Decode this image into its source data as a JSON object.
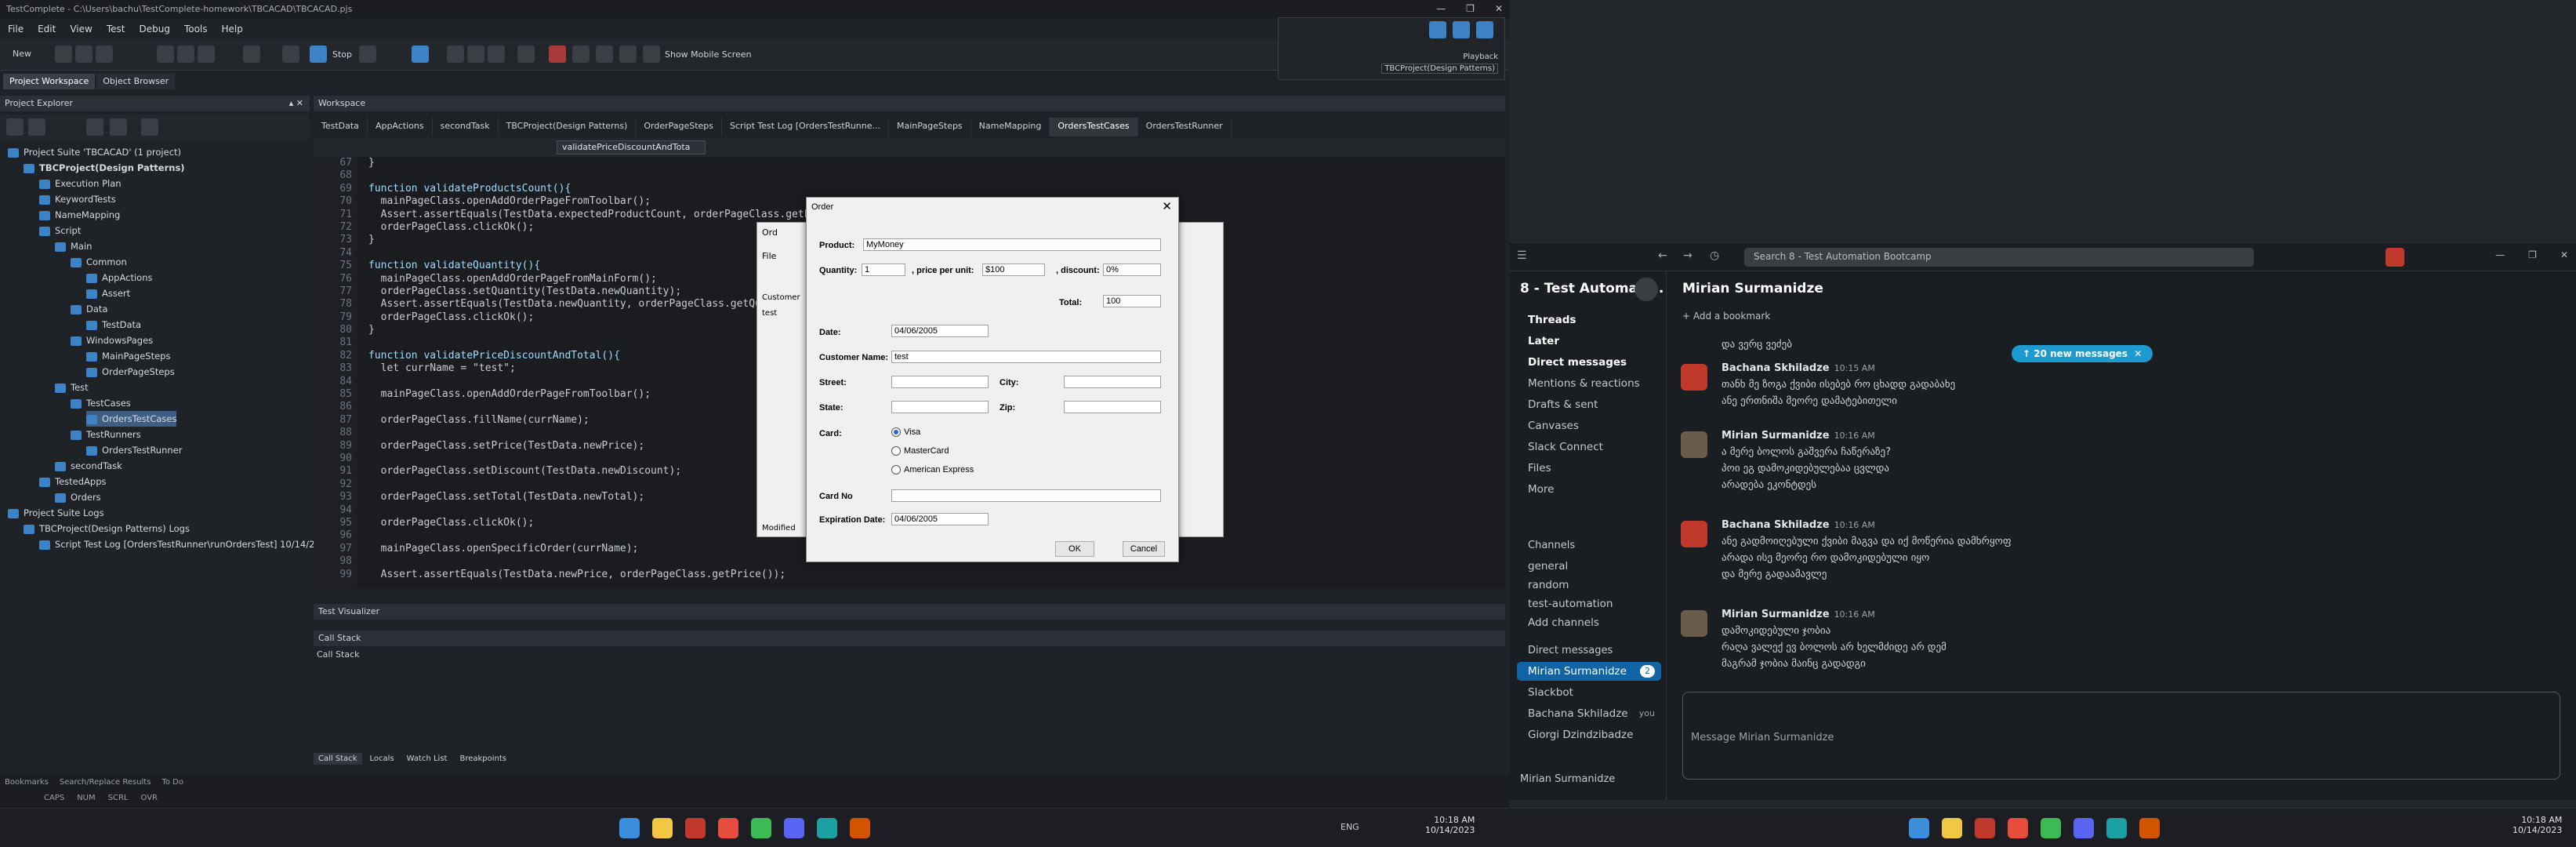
{
  "left": {
    "title": "TestComplete - C:\\Users\\bachu\\TestComplete-homework\\TBCACAD\\TBCACAD.pjs",
    "menu": [
      "File",
      "Edit",
      "View",
      "Test",
      "Debug",
      "Tools",
      "Help"
    ],
    "toolbar": {
      "new_label": "New",
      "stop_label": "Stop",
      "mobile_label": "Show Mobile Screen",
      "playback_label": "Playback",
      "playback_sub": "TBCProject(Design Patterns)"
    },
    "pw_tabs": [
      "Project Workspace",
      "Object Browser"
    ],
    "explorer_title": "Project Explorer",
    "workspace_title": "Workspace",
    "tree": [
      {
        "label": "Project Suite 'TBCACAD' (1 project)",
        "indent": 0,
        "bold": false
      },
      {
        "label": "TBCProject(Design Patterns)",
        "indent": 1,
        "bold": true
      },
      {
        "label": "Execution Plan",
        "indent": 2,
        "bold": false
      },
      {
        "label": "KeywordTests",
        "indent": 2,
        "bold": false
      },
      {
        "label": "NameMapping",
        "indent": 2,
        "bold": false
      },
      {
        "label": "Script",
        "indent": 2,
        "bold": false
      },
      {
        "label": "Main",
        "indent": 3,
        "bold": false
      },
      {
        "label": "Common",
        "indent": 4,
        "bold": false
      },
      {
        "label": "AppActions",
        "indent": 5,
        "bold": false
      },
      {
        "label": "Assert",
        "indent": 5,
        "bold": false
      },
      {
        "label": "Data",
        "indent": 4,
        "bold": false
      },
      {
        "label": "TestData",
        "indent": 5,
        "bold": false
      },
      {
        "label": "WindowsPages",
        "indent": 4,
        "bold": false
      },
      {
        "label": "MainPageSteps",
        "indent": 5,
        "bold": false
      },
      {
        "label": "OrderPageSteps",
        "indent": 5,
        "bold": false
      },
      {
        "label": "Test",
        "indent": 3,
        "bold": false
      },
      {
        "label": "TestCases",
        "indent": 4,
        "bold": false
      },
      {
        "label": "OrdersTestCases",
        "indent": 5,
        "bold": false,
        "selected": true
      },
      {
        "label": "TestRunners",
        "indent": 4,
        "bold": false
      },
      {
        "label": "OrdersTestRunner",
        "indent": 5,
        "bold": false
      },
      {
        "label": "secondTask",
        "indent": 3,
        "bold": false
      },
      {
        "label": "TestedApps",
        "indent": 2,
        "bold": false
      },
      {
        "label": "Orders",
        "indent": 3,
        "bold": false
      },
      {
        "label": "Project Suite Logs",
        "indent": 0,
        "bold": false
      },
      {
        "label": "TBCProject(Design Patterns) Logs",
        "indent": 1,
        "bold": false
      },
      {
        "label": "Script Test Log [OrdersTestRunner\\runOrdersTest] 10/14/2023",
        "indent": 2,
        "bold": false
      }
    ],
    "doc_tabs": [
      "TestData",
      "AppActions",
      "secondTask",
      "TBCProject(Design Patterns)",
      "OrderPageSteps",
      "Script Test Log [OrdersTestRunne...",
      "MainPageSteps",
      "NameMapping",
      "OrdersTestCases",
      "OrdersTestRunner"
    ],
    "function_select": "validatePriceDiscountAndTota",
    "code_lines": [
      {
        "n": "67",
        "t": "}"
      },
      {
        "n": "68",
        "t": ""
      },
      {
        "n": "69",
        "t": "function validateProductsCount(){"
      },
      {
        "n": "70",
        "t": "  mainPageClass.openAddOrderPageFromToolbar();"
      },
      {
        "n": "71",
        "t": "  Assert.assertEquals(TestData.expectedProductCount, orderPageClass.getPr..."
      },
      {
        "n": "72",
        "t": "  orderPageClass.clickOk();"
      },
      {
        "n": "73",
        "t": "}"
      },
      {
        "n": "74",
        "t": ""
      },
      {
        "n": "75",
        "t": "function validateQuantity(){"
      },
      {
        "n": "76",
        "t": "  mainPageClass.openAddOrderPageFromMainForm();"
      },
      {
        "n": "77",
        "t": "  orderPageClass.setQuantity(TestData.newQuantity);"
      },
      {
        "n": "78",
        "t": "  Assert.assertEquals(TestData.newQuantity, orderPageClass.getQuantity());"
      },
      {
        "n": "79",
        "t": "  orderPageClass.clickOk();"
      },
      {
        "n": "80",
        "t": "}"
      },
      {
        "n": "81",
        "t": ""
      },
      {
        "n": "82",
        "t": "function validatePriceDiscountAndTotal(){"
      },
      {
        "n": "83",
        "t": "  let currName = \"test\";"
      },
      {
        "n": "84",
        "t": ""
      },
      {
        "n": "85",
        "t": "  mainPageClass.openAddOrderPageFromToolbar();"
      },
      {
        "n": "86",
        "t": ""
      },
      {
        "n": "87",
        "t": "  orderPageClass.fillName(currName);"
      },
      {
        "n": "88",
        "t": ""
      },
      {
        "n": "89",
        "t": "  orderPageClass.setPrice(TestData.newPrice);"
      },
      {
        "n": "90",
        "t": ""
      },
      {
        "n": "91",
        "t": "  orderPageClass.setDiscount(TestData.newDiscount);"
      },
      {
        "n": "92",
        "t": ""
      },
      {
        "n": "93",
        "t": "  orderPageClass.setTotal(TestData.newTotal);"
      },
      {
        "n": "94",
        "t": ""
      },
      {
        "n": "95",
        "t": "  orderPageClass.clickOk();"
      },
      {
        "n": "96",
        "t": ""
      },
      {
        "n": "97",
        "t": "  mainPageClass.openSpecificOrder(currName);"
      },
      {
        "n": "98",
        "t": ""
      },
      {
        "n": "99",
        "t": "  Assert.assertEquals(TestData.newPrice, orderPageClass.getPrice());"
      }
    ],
    "test_visualizer": "Test Visualizer",
    "call_stack_title": "Call Stack",
    "call_stack_col": "Call Stack",
    "bottom_tabs": [
      "Call Stack",
      "Locals",
      "Watch List",
      "Breakpoints"
    ],
    "status_tabs": [
      "Bookmarks",
      "Search/Replace Results",
      "To Do"
    ],
    "status_keys": [
      "CAPS",
      "NUM",
      "SCRL",
      "OVR"
    ],
    "back_dialog": {
      "title": "Ord",
      "menu": "File",
      "col": "Customer",
      "row": "test",
      "status": "Modified"
    },
    "dialog": {
      "title": "Order",
      "product_label": "Product:",
      "product_value": "MyMoney",
      "quantity_label": "Quantity:",
      "quantity_value": "1",
      "price_label": ", price per unit:",
      "price_value": "$100",
      "discount_label": ", discount:",
      "discount_value": "0%",
      "total_label": "Total:",
      "total_value": "100",
      "date_label": "Date:",
      "date_value": "04/06/2005",
      "customer_label": "Customer Name:",
      "customer_value": "test",
      "street_label": "Street:",
      "city_label": "City:",
      "state_label": "State:",
      "zip_label": "Zip:",
      "card_label": "Card:",
      "cards": [
        "Visa",
        "MasterCard",
        "American Express"
      ],
      "card_selected": "Visa",
      "cardno_label": "Card No",
      "exp_label": "Expiration Date:",
      "exp_value": "04/06/2005",
      "ok_label": "OK",
      "cancel_label": "Cancel"
    },
    "clock": {
      "time": "10:18 AM",
      "date": "10/14/2023",
      "lang": "ENG"
    }
  },
  "right": {
    "search_placeholder": "Search 8 - Test Automation Bootcamp",
    "workspace": "8 - Test Automati...",
    "sidebar_top": [
      "Threads",
      "Later",
      "Direct messages",
      "Mentions & reactions",
      "Drafts & sent",
      "Canvases",
      "Slack Connect",
      "Files",
      "More"
    ],
    "channels_header": "Channels",
    "channels": [
      "general",
      "random",
      "test-automation"
    ],
    "add_channels": "Add channels",
    "dm_header": "Direct messages",
    "dms": [
      {
        "name": "Mirian Surmanidze",
        "badge": "2",
        "selected": true
      },
      {
        "name": "Slackbot",
        "badge": "",
        "selected": false
      },
      {
        "name": "Bachana Skhiladze",
        "badge": "you",
        "selected": false
      },
      {
        "name": "Giorgi Dzindzibadze",
        "badge": "",
        "selected": false
      }
    ],
    "footer_user": "Mirian Surmanidze",
    "channel_title": "Mirian Surmanidze",
    "add_bookmark": "Add a bookmark",
    "new_messages": "20 new messages",
    "messages": [
      {
        "lines": [
          "და ვერც ვეძებ"
        ],
        "name": "",
        "time": ""
      },
      {
        "name": "Bachana Skhiladze",
        "time": "10:15 AM",
        "lines": [
          "თანხ მე ზოგა ქვიბი ისებებ რო ცხადდ გადაბახე",
          "ანე ერთნიშა მეორე დამატებითელი"
        ]
      },
      {
        "name": "Mirian Surmanidze",
        "time": "10:16 AM",
        "lines": [
          "ა მერე ბოლოს გაშვერა ჩაწერაზე?",
          "პოი ეგ დამოკიდებულებაა ცვლდა",
          "არადება ეკონტდეს"
        ]
      },
      {
        "name": "Bachana Skhiladze",
        "time": "10:16 AM",
        "lines": [
          "ანე გადმოიღებული ქვიბი მაგვა და იქ მოწერია დამხრყოფ",
          "არადა ისე მეორე რო დამოკიდებული იყო",
          "და მერე გადაამავლე"
        ]
      },
      {
        "name": "Mirian Surmanidze",
        "time": "10:16 AM",
        "lines": [
          "დამოკიდებული ჯობია",
          "რაღა ვალექ ევ ბოლოს არ ხელმძიდე არ დემ",
          "მაგრამ ჯობია მაინც გადადგი"
        ]
      }
    ],
    "composer_placeholder": "Message Mirian Surmanidze",
    "clock": {
      "time": "10:18 AM",
      "date": "10/14/2023"
    }
  }
}
